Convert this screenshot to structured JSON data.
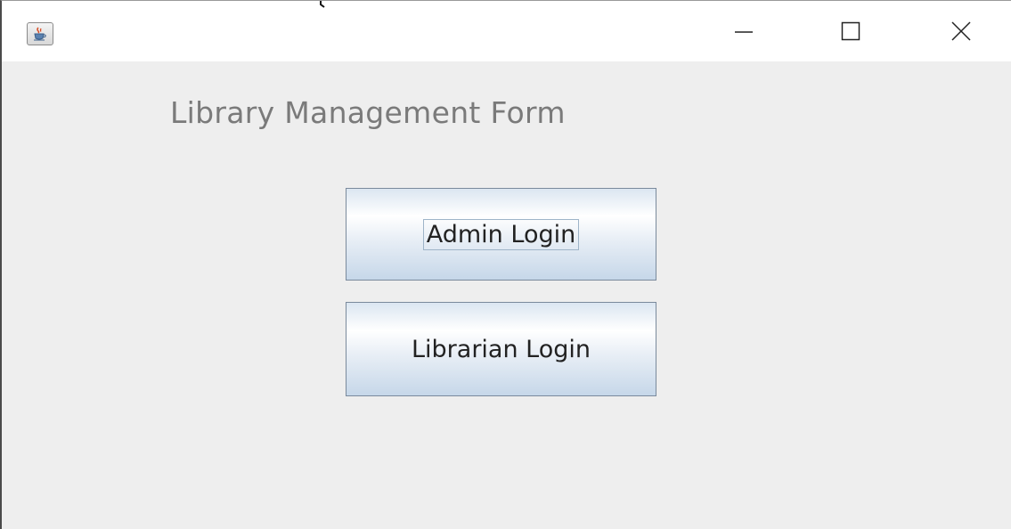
{
  "window": {
    "title": "",
    "icon": "java-coffee-cup-icon",
    "controls": {
      "minimize": "minimize-icon",
      "maximize": "maximize-icon",
      "close": "close-icon"
    }
  },
  "form": {
    "title": "Library Management Form",
    "buttons": {
      "admin_label": "Admin Login",
      "librarian_label": "Librarian Login"
    }
  },
  "colors": {
    "content_background": "#eeeeee",
    "title_text": "#7a7a7a",
    "button_gradient_top": "#ffffff",
    "button_gradient_bottom": "#c6d7e9",
    "button_border": "#7a8a9c"
  }
}
